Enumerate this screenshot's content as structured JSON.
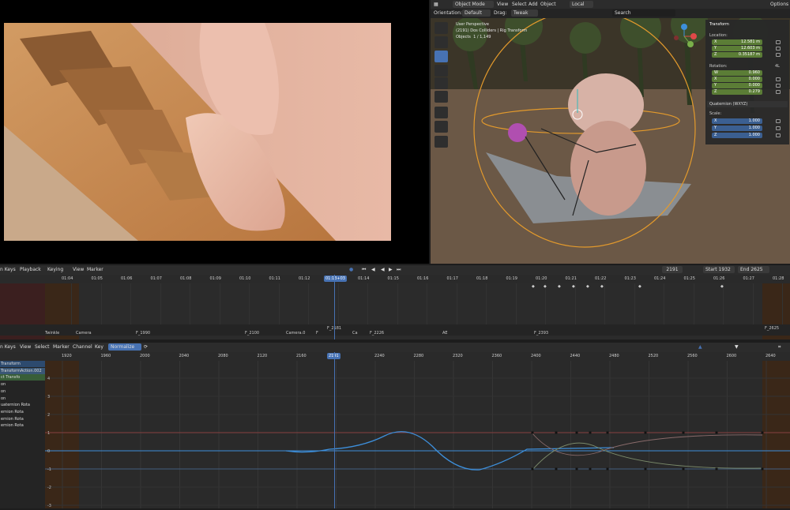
{
  "viewport": {
    "header": {
      "editor_icon": "3d-viewport-icon",
      "mode": "Object Mode",
      "menus": [
        "View",
        "Select",
        "Add",
        "Object"
      ],
      "pivot": "Local",
      "options": "Options"
    },
    "header2": {
      "orientation_label": "Orientation:",
      "orientation": "Default",
      "drag_label": "Drag:",
      "drag": "Tweak",
      "search_placeholder": "Search"
    },
    "overlay": {
      "line1": "User Perspective",
      "line2": "(2191) Dos Colliders | Rig Transform",
      "objects_label": "Objects",
      "objects_value": "1 / 1,149"
    },
    "tools": [
      "select-box-icon",
      "cursor-icon",
      "move-icon",
      "rotate-icon",
      "scale-icon",
      "transform-icon",
      "annotate-icon",
      "measure-icon",
      "add-cube-icon"
    ]
  },
  "transform": {
    "title": "Transform",
    "location_label": "Location:",
    "location": [
      {
        "axis": "X",
        "value": "12.581 m"
      },
      {
        "axis": "Y",
        "value": "12.603 m"
      },
      {
        "axis": "Z",
        "value": "0.35187 m"
      }
    ],
    "rotation_label": "Rotation:",
    "rotation_mode_short": "4L",
    "rotation": [
      {
        "axis": "W",
        "value": "0.960"
      },
      {
        "axis": "X",
        "value": "0.000"
      },
      {
        "axis": "Y",
        "value": "0.000"
      },
      {
        "axis": "Z",
        "value": "0.279"
      }
    ],
    "rotation_mode": "Quaternion (WXYZ)",
    "scale_label": "Scale:",
    "scale": [
      {
        "axis": "X",
        "value": "1.000"
      },
      {
        "axis": "Y",
        "value": "1.000"
      },
      {
        "axis": "Z",
        "value": "1.000"
      }
    ]
  },
  "timeline": {
    "header": {
      "keys": "n Keys",
      "menus": [
        "Playback",
        "Keying",
        "View",
        "Marker"
      ],
      "frame": "2191",
      "start_label": "Start",
      "start": "1932",
      "end_label": "End",
      "end": "2625"
    },
    "ruler": [
      "01:04",
      "01:05",
      "01:06",
      "01:07",
      "01:08",
      "01:09",
      "01:10",
      "01:11",
      "01:12",
      "01:13+03",
      "01:14",
      "01:15",
      "01:16",
      "01:17",
      "01:18",
      "01:19",
      "01:20",
      "01:21",
      "01:22",
      "01:23",
      "01:24",
      "01:25",
      "01:26",
      "01:27",
      "01:28"
    ],
    "current": "01:13+03",
    "markers": [
      "Twinkle",
      "Camera",
      "F_1990",
      "F_2100",
      "Camera.0",
      "F",
      "F_2181",
      "Ca",
      "F_2226",
      "AE",
      "F_2393",
      "F_2625"
    ]
  },
  "graph": {
    "header": {
      "keys": "n Keys",
      "menus": [
        "View",
        "Select",
        "Marker",
        "Channel",
        "Key"
      ],
      "normalize": "Normalize"
    },
    "ruler": [
      "1920",
      "1960",
      "2000",
      "2040",
      "2080",
      "2120",
      "2160",
      "2191",
      "2240",
      "2280",
      "2320",
      "2360",
      "2400",
      "2440",
      "2480",
      "2520",
      "2560",
      "2600",
      "2640"
    ],
    "current": "2191",
    "yaxis": [
      "4",
      "3",
      "2",
      "1",
      "0",
      "-1",
      "-2",
      "-3"
    ],
    "channels": [
      "Transform",
      "TransformAction.002",
      "ct Transfo",
      "on",
      "on",
      "on",
      "uaternion Rota",
      "ernion Rota",
      "ernion Rota",
      "ernion Rota",
      "",
      "",
      "",
      ""
    ]
  },
  "colors": {
    "accent": "#4772b3",
    "field_loc": "#5b7d36",
    "field_rot": "#3b5f91",
    "curve_blue": "#3d8fdb",
    "curve_red": "#c24a4a",
    "curve_green": "#7aa84a",
    "range_out": "#4a2a1a"
  }
}
